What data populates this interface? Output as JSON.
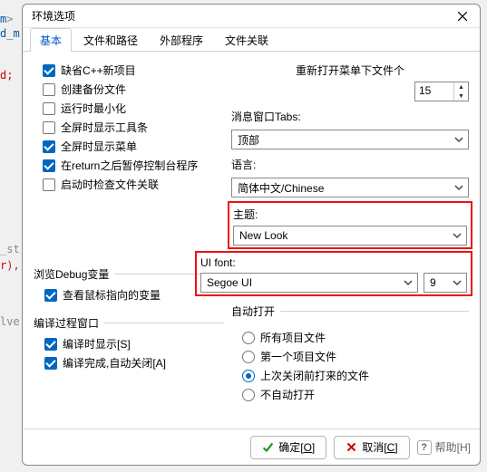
{
  "bg": {
    "l1a": "m",
    "l1b": ">",
    "l2": "d_m",
    "l3": "d;",
    "l4": "_st",
    "l5a": "r",
    "l5b": "),",
    "l6": "lve"
  },
  "window": {
    "title": "环境选项"
  },
  "tabs": [
    "基本",
    "文件和路径",
    "外部程序",
    "文件关联"
  ],
  "checks": [
    {
      "label": "缺省C++新项目",
      "checked": true
    },
    {
      "label": "创建备份文件",
      "checked": false
    },
    {
      "label": "运行时最小化",
      "checked": false
    },
    {
      "label": "全屏时显示工具条",
      "checked": false
    },
    {
      "label": "全屏时显示菜单",
      "checked": true
    },
    {
      "label": "在return之后暂停控制台程序",
      "checked": true
    },
    {
      "label": "启动时检查文件关联",
      "checked": false
    }
  ],
  "right": {
    "reopen_label": "重新打开菜单下文件个",
    "reopen_value": "15",
    "msg_label": "消息窗口Tabs:",
    "msg_value": "顶部",
    "lang_label": "语言:",
    "lang_value": "简体中文/Chinese",
    "theme_label": "主题:",
    "theme_value": "New Look",
    "font_label": "UI font:",
    "font_value": "Segoe UI",
    "font_size": "9"
  },
  "debug": {
    "header": "浏览Debug变量",
    "chk_label": "查看鼠标指向的变量",
    "chk_checked": true
  },
  "compile": {
    "header": "编译过程窗口",
    "chk1_label": "编译时显示[S]",
    "chk2_label": "编译完成,自动关闭[A]"
  },
  "autoopen": {
    "header": "自动打开",
    "opts": [
      "所有项目文件",
      "第一个项目文件",
      "上次关闭前打来的文件",
      "不自动打开"
    ],
    "selected": 2
  },
  "footer": {
    "ok": "确定",
    "ok_u": "[O]",
    "cancel": "取消",
    "cancel_u": "[C]",
    "help": "帮助",
    "help_u": "[H]"
  }
}
